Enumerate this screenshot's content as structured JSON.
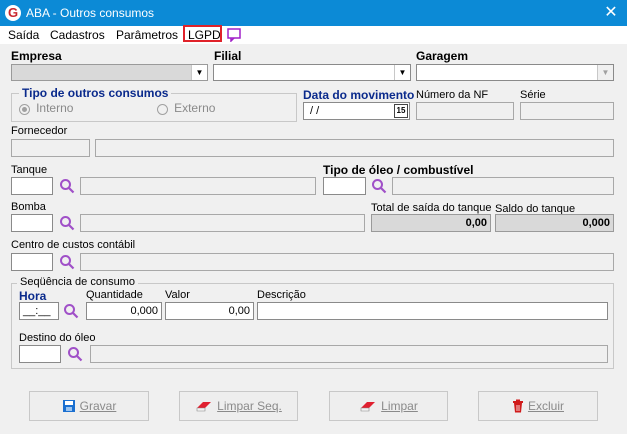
{
  "window": {
    "title": "ABA - Outros consumos",
    "app_icon": "G",
    "close": "✕"
  },
  "menu": {
    "items": [
      "Saída",
      "Cadastros",
      "Parâmetros",
      "LGPD"
    ]
  },
  "empresa": {
    "label": "Empresa",
    "value": ""
  },
  "filial": {
    "label": "Filial",
    "value": ""
  },
  "garagem": {
    "label": "Garagem",
    "value": ""
  },
  "tipo_consumo": {
    "title": "Tipo de outros consumos",
    "interno": "Interno",
    "externo": "Externo",
    "selected": "Interno"
  },
  "data_movimento": {
    "label": "Data do movimento",
    "value": " /  /",
    "calendar": "15"
  },
  "numero_nf": {
    "label": "Número da NF",
    "value": ""
  },
  "serie": {
    "label": "Série",
    "value": ""
  },
  "fornecedor": {
    "label": "Fornecedor",
    "code": "",
    "name": ""
  },
  "tanque": {
    "label": "Tanque",
    "code": "",
    "desc": ""
  },
  "tipo_oleo": {
    "label": "Tipo de óleo / combustível",
    "code": "",
    "desc": ""
  },
  "bomba": {
    "label": "Bomba",
    "code": "",
    "desc": ""
  },
  "total_saida": {
    "label": "Total de saída do tanque",
    "value": "0,00"
  },
  "saldo_tanque": {
    "label": "Saldo do tanque",
    "value": "0,000"
  },
  "centro_custos": {
    "label": "Centro de custos contábil",
    "code": "",
    "desc": ""
  },
  "sequencia": {
    "title": "Seqüência de consumo",
    "hora_label": "Hora",
    "hora_value": "__:__",
    "quantidade_label": "Quantidade",
    "quantidade_value": "0,000",
    "valor_label": "Valor",
    "valor_value": "0,00",
    "descricao_label": "Descrição",
    "descricao_value": "",
    "destino_label": "Destino do óleo",
    "destino_code": "",
    "destino_desc": ""
  },
  "buttons": {
    "gravar": "Gravar",
    "limpar_seq": "Limpar Seq.",
    "limpar": "Limpar",
    "excluir": "Excluir"
  },
  "colors": {
    "titlebar": "#0c8ad6",
    "accent_blue": "#0a2a8c",
    "search_icon": "#a050c8",
    "highlight": "#e0222a"
  }
}
